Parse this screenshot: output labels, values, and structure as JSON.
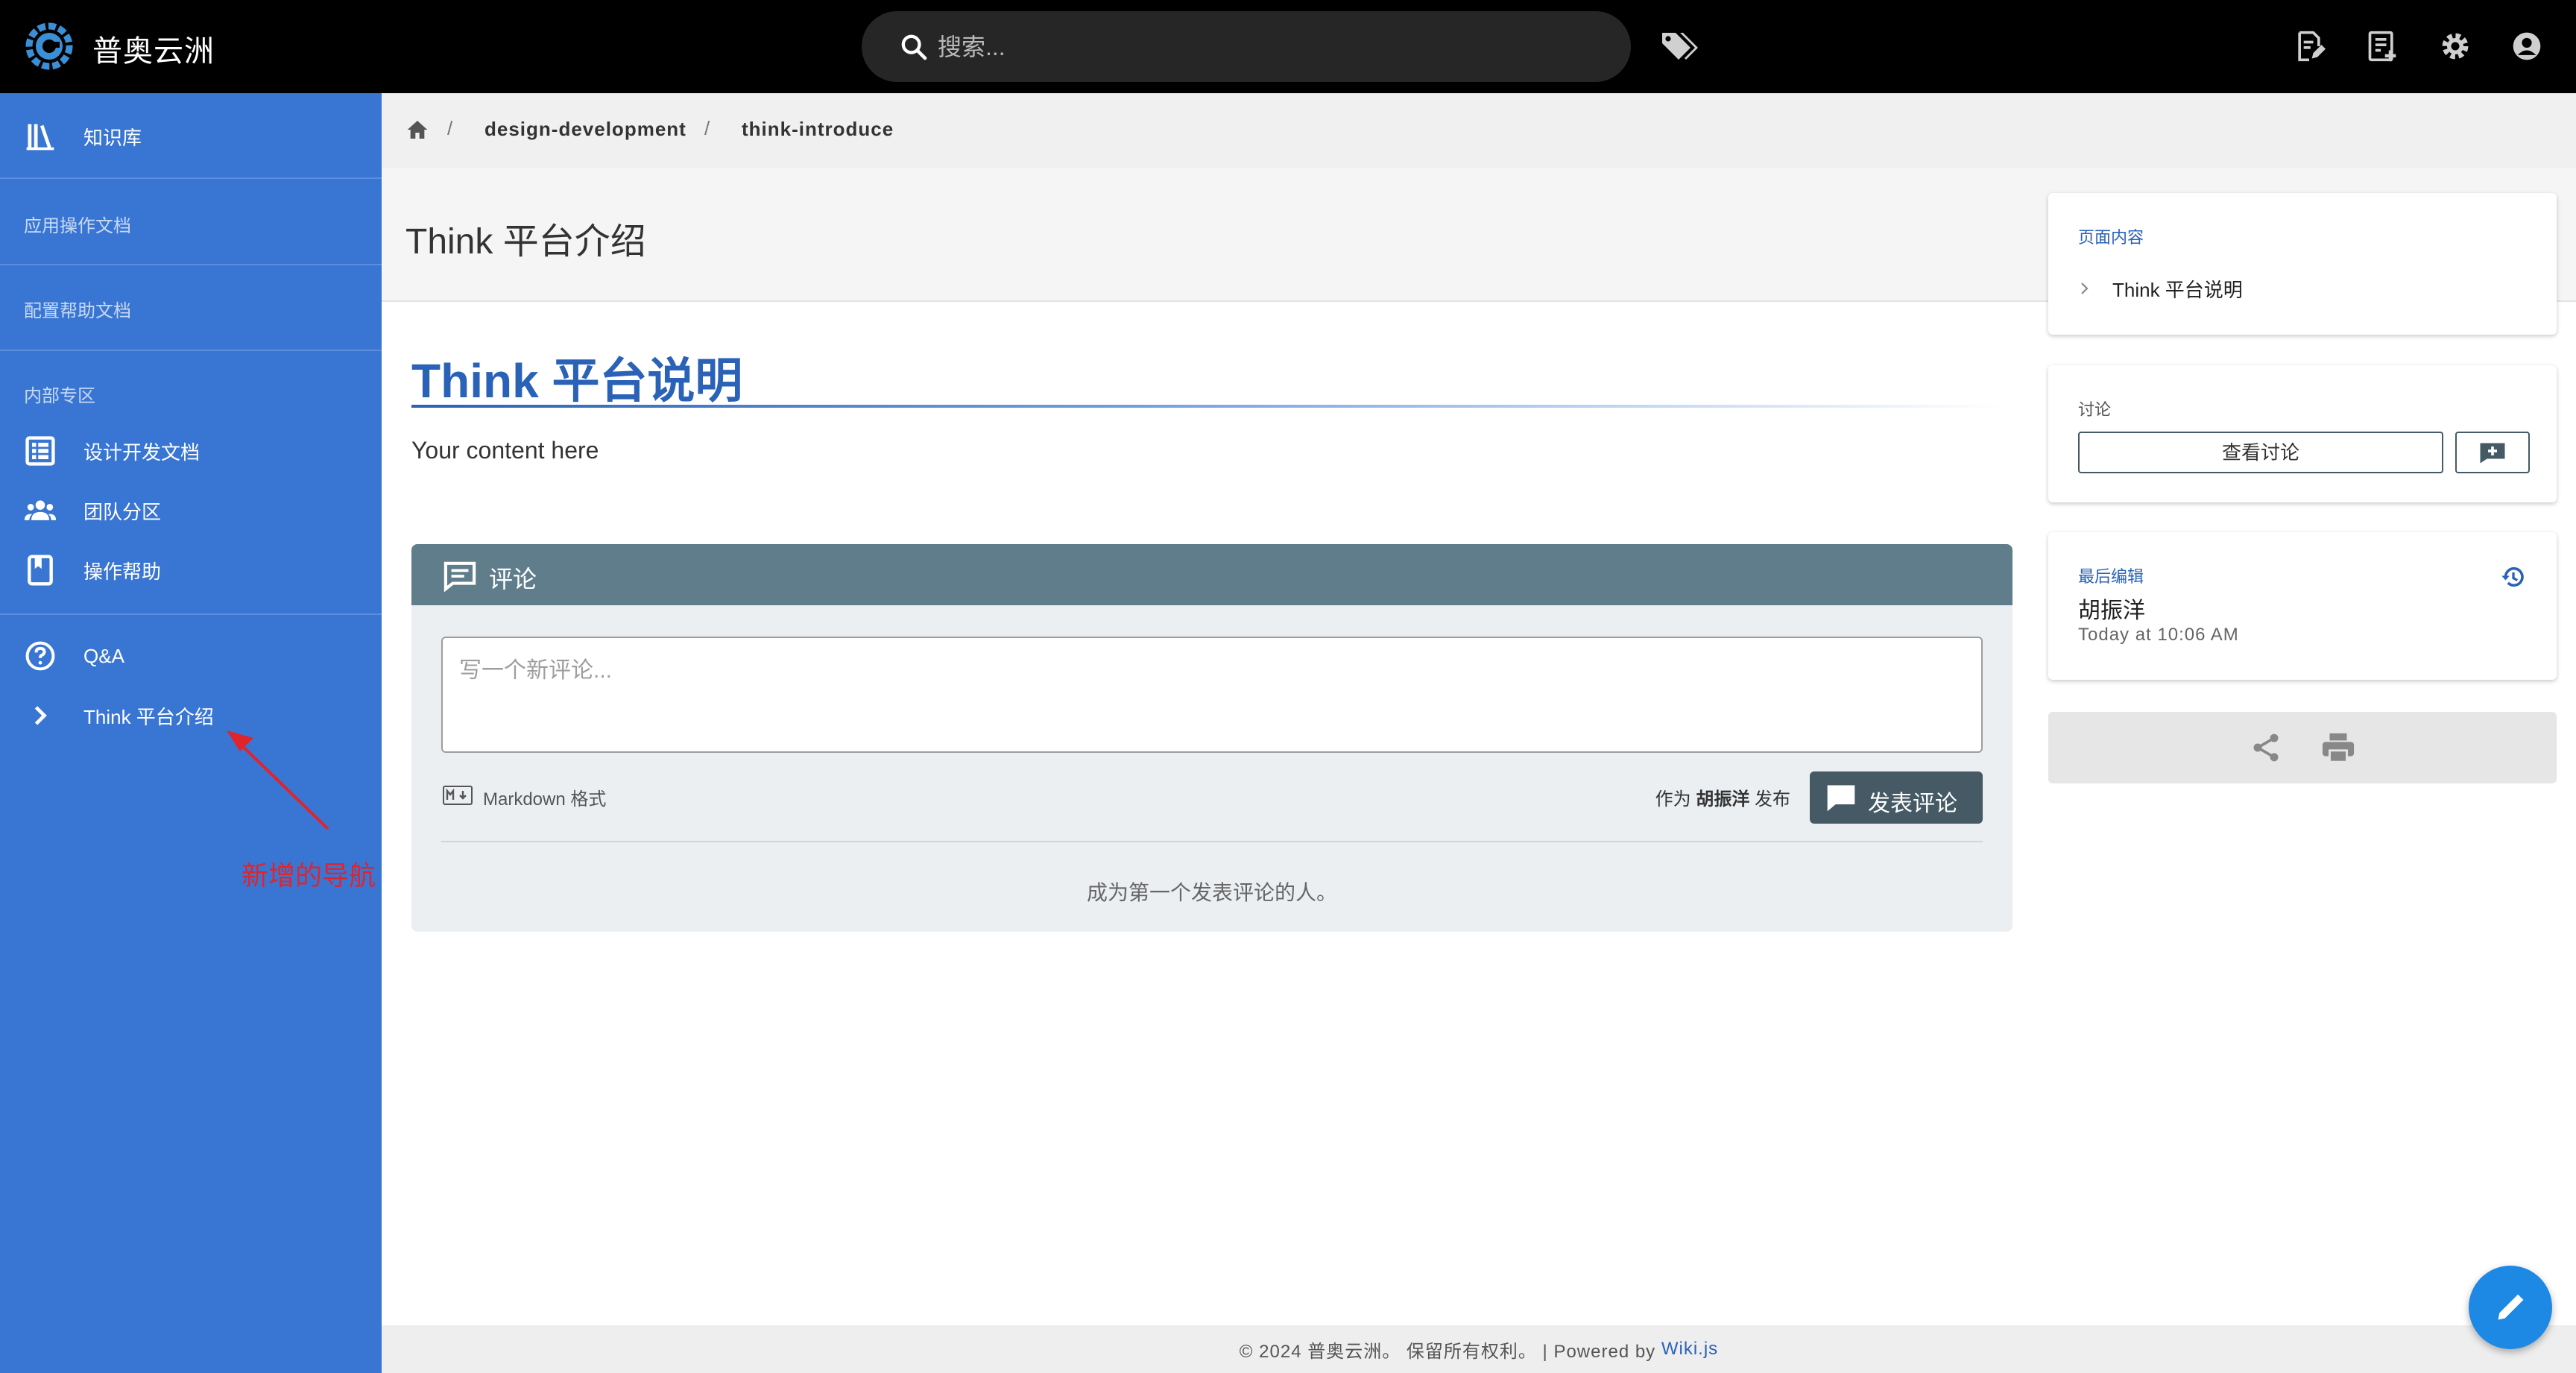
{
  "app": {
    "title": "普奥云洲"
  },
  "search": {
    "placeholder": "搜索..."
  },
  "sidebar": {
    "knowledge_base": "知识库",
    "header_app_docs": "应用操作文档",
    "header_config_docs": "配置帮助文档",
    "header_internal": "内部专区",
    "items": [
      {
        "label": "设计开发文档",
        "icon": "grid-icon"
      },
      {
        "label": "团队分区",
        "icon": "team-icon"
      },
      {
        "label": "操作帮助",
        "icon": "bookmark-icon"
      },
      {
        "label": "Q&A",
        "icon": "help-circle-icon"
      },
      {
        "label": "Think 平台介绍",
        "icon": "chevron-right-icon"
      }
    ],
    "annotation": "新增的导航"
  },
  "breadcrumb": [
    "design-development",
    "think-introduce"
  ],
  "page": {
    "title": "Think 平台介绍",
    "heading": "Think 平台说明",
    "body": "Your content here"
  },
  "comments": {
    "title": "评论",
    "placeholder": "写一个新评论...",
    "markdown_label": "Markdown 格式",
    "post_as_prefix": "作为",
    "post_as_user": "胡振洋",
    "post_as_suffix": "发布",
    "post_button": "发表评论",
    "empty_message": "成为第一个发表评论的人。"
  },
  "toc": {
    "label": "页面内容",
    "items": [
      "Think 平台说明"
    ]
  },
  "discussion": {
    "label": "讨论",
    "view_button": "查看讨论"
  },
  "last_edit": {
    "label": "最后编辑",
    "author": "胡振洋",
    "time": "Today at 10:06 AM"
  },
  "footer": {
    "text": "© 2024 普奥云洲。 保留所有权利。 | Powered by",
    "link": "Wiki.js"
  },
  "colors": {
    "sidebar": "#3976d3",
    "topbar": "#000000",
    "heading": "#2a62b8",
    "comments_header": "#607d8b",
    "post_button": "#455a64",
    "fab": "#1e88e5",
    "annotation": "#e0242b"
  }
}
